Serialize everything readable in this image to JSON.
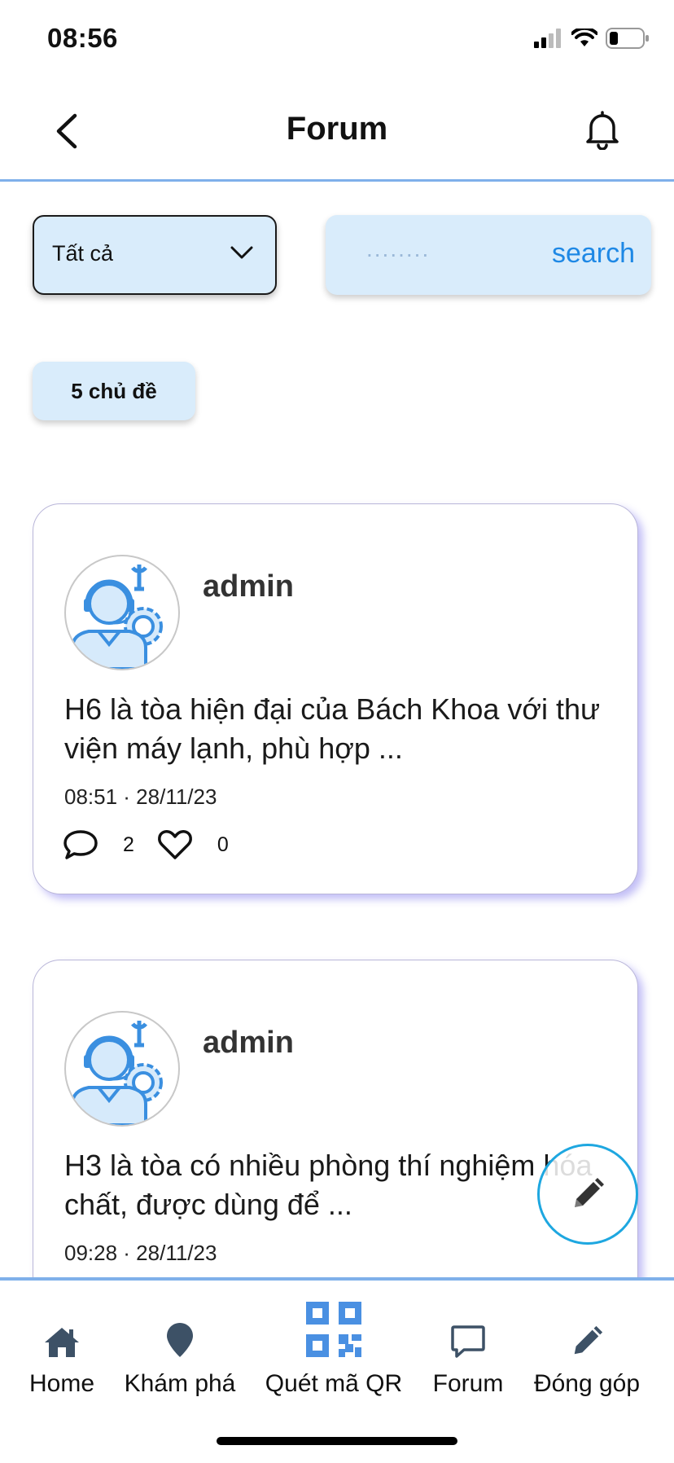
{
  "status_bar": {
    "time": "08:56"
  },
  "header": {
    "title": "Forum"
  },
  "filter": {
    "selected": "Tất cả"
  },
  "search": {
    "placeholder": "........",
    "button_label": "search"
  },
  "topic_count": "5 chủ đề",
  "posts": [
    {
      "author": "admin",
      "text": "H6 là tòa hiện đại của Bách Khoa với thư viện máy lạnh, phù hợp ...",
      "time": "08:51 · 28/11/23",
      "comments": "2",
      "likes": "0"
    },
    {
      "author": "admin",
      "text": "H3 là tòa có nhiều phòng thí nghiệm hóa chất, được dùng để ...",
      "time": "09:28 · 28/11/23"
    }
  ],
  "nav": {
    "items": [
      {
        "label": "Home",
        "icon": "home-icon"
      },
      {
        "label": "Khám phá",
        "icon": "map-pin-icon"
      },
      {
        "label": "Quét mã QR",
        "icon": "qr-code-icon"
      },
      {
        "label": "Forum",
        "icon": "chat-bubble-icon"
      },
      {
        "label": "Đóng góp",
        "icon": "pencil-icon"
      }
    ]
  },
  "colors": {
    "accent": "#1e88e5",
    "light_blue": "#d9ecfb",
    "divider": "#7fb0ea",
    "fab_border": "#1ea7e0",
    "nav_icon": "#3d5166",
    "qr_icon": "#4a90e2"
  }
}
